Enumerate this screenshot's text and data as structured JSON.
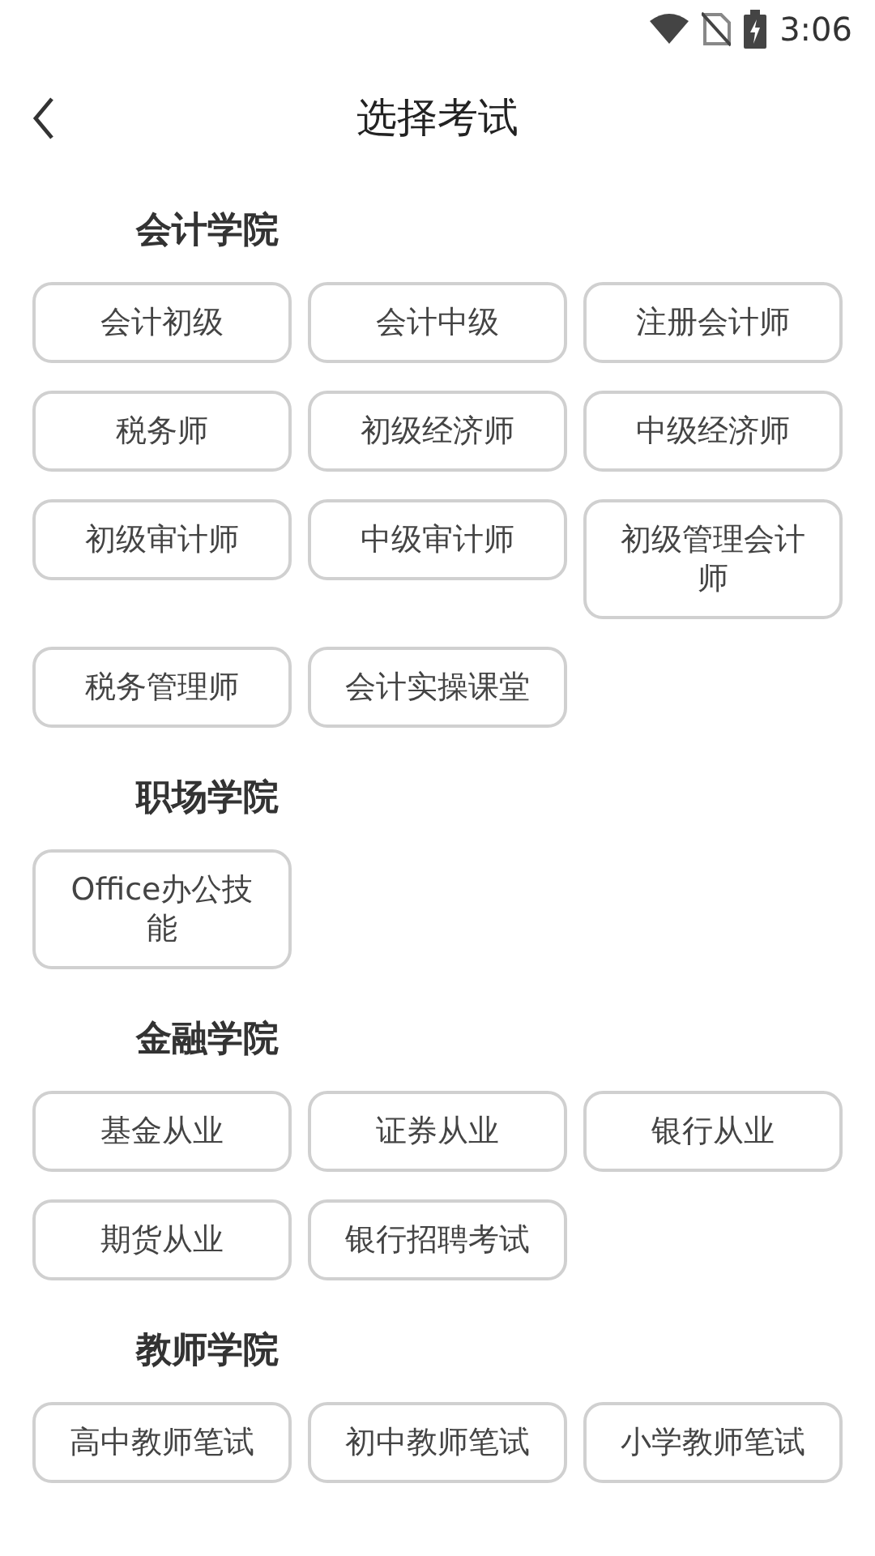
{
  "status_bar": {
    "time": "3:06"
  },
  "header": {
    "title": "选择考试"
  },
  "sections": [
    {
      "title": "会计学院",
      "exams": [
        "会计初级",
        "会计中级",
        "注册会计师",
        "税务师",
        "初级经济师",
        "中级经济师",
        "初级审计师",
        "中级审计师",
        "初级管理会计师",
        "税务管理师",
        "会计实操课堂"
      ]
    },
    {
      "title": "职场学院",
      "exams": [
        "Office办公技能"
      ]
    },
    {
      "title": "金融学院",
      "exams": [
        "基金从业",
        "证券从业",
        "银行从业",
        "期货从业",
        "银行招聘考试"
      ]
    },
    {
      "title": "教师学院",
      "exams": [
        "高中教师笔试",
        "初中教师笔试",
        "小学教师笔试"
      ]
    }
  ]
}
